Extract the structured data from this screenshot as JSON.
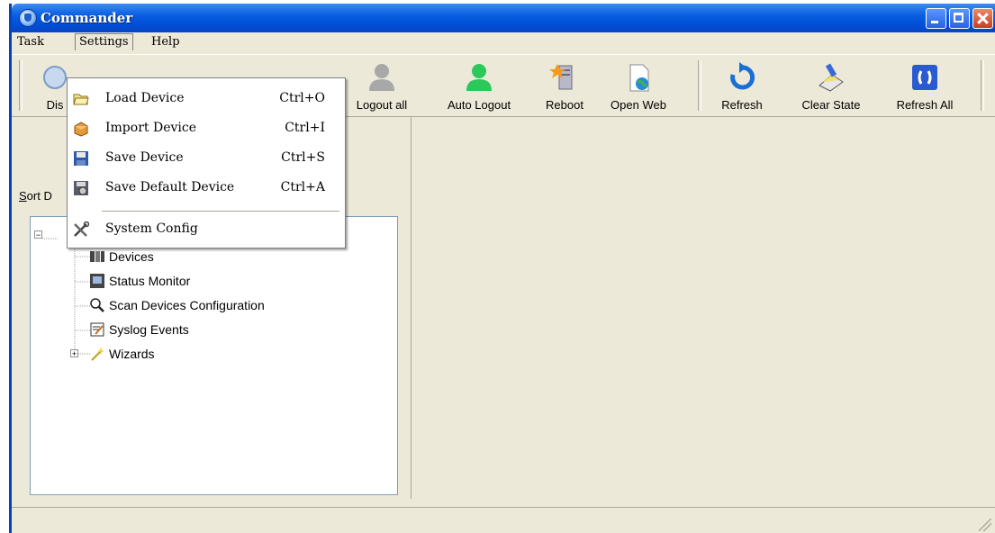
{
  "window": {
    "title": "Commander"
  },
  "menubar": {
    "items": [
      "Task",
      "Settings",
      "Help"
    ]
  },
  "toolbar": {
    "items": [
      {
        "label": "Dis",
        "icon": "disconnect-icon"
      },
      {
        "label": "Logout all",
        "icon": "logout-all-icon"
      },
      {
        "label": "Auto Logout",
        "icon": "auto-logout-icon"
      },
      {
        "label": "Reboot",
        "icon": "reboot-icon"
      },
      {
        "label": "Open Web",
        "icon": "open-web-icon"
      },
      {
        "label": "Refresh",
        "icon": "refresh-icon"
      },
      {
        "label": "Clear State",
        "icon": "clear-state-icon"
      },
      {
        "label": "Refresh All",
        "icon": "refresh-all-icon"
      }
    ]
  },
  "sort": {
    "label": "Sort D"
  },
  "tree": {
    "items": [
      {
        "label": "Devices",
        "icon": "devices-icon"
      },
      {
        "label": "Status Monitor",
        "icon": "monitor-icon"
      },
      {
        "label": "Scan Devices Configuration",
        "icon": "magnifier-icon"
      },
      {
        "label": "Syslog Events",
        "icon": "notepad-icon"
      },
      {
        "label": "Wizards",
        "icon": "wand-icon"
      }
    ]
  },
  "settings_menu": {
    "items": [
      {
        "label": "Load Device",
        "shortcut": "Ctrl+O",
        "icon": "folder-open-icon"
      },
      {
        "label": "Import Device",
        "shortcut": "Ctrl+I",
        "icon": "import-icon"
      },
      {
        "label": "Save Device",
        "shortcut": "Ctrl+S",
        "icon": "floppy-icon"
      },
      {
        "label": "Save Default Device",
        "shortcut": "Ctrl+A",
        "icon": "save-default-icon"
      },
      {
        "label": "System Config",
        "shortcut": "",
        "icon": "tools-icon"
      }
    ]
  },
  "colors": {
    "titlebar": "#0050d8",
    "menu_bg": "#ece9d8",
    "accent": "#1a6fd6"
  }
}
